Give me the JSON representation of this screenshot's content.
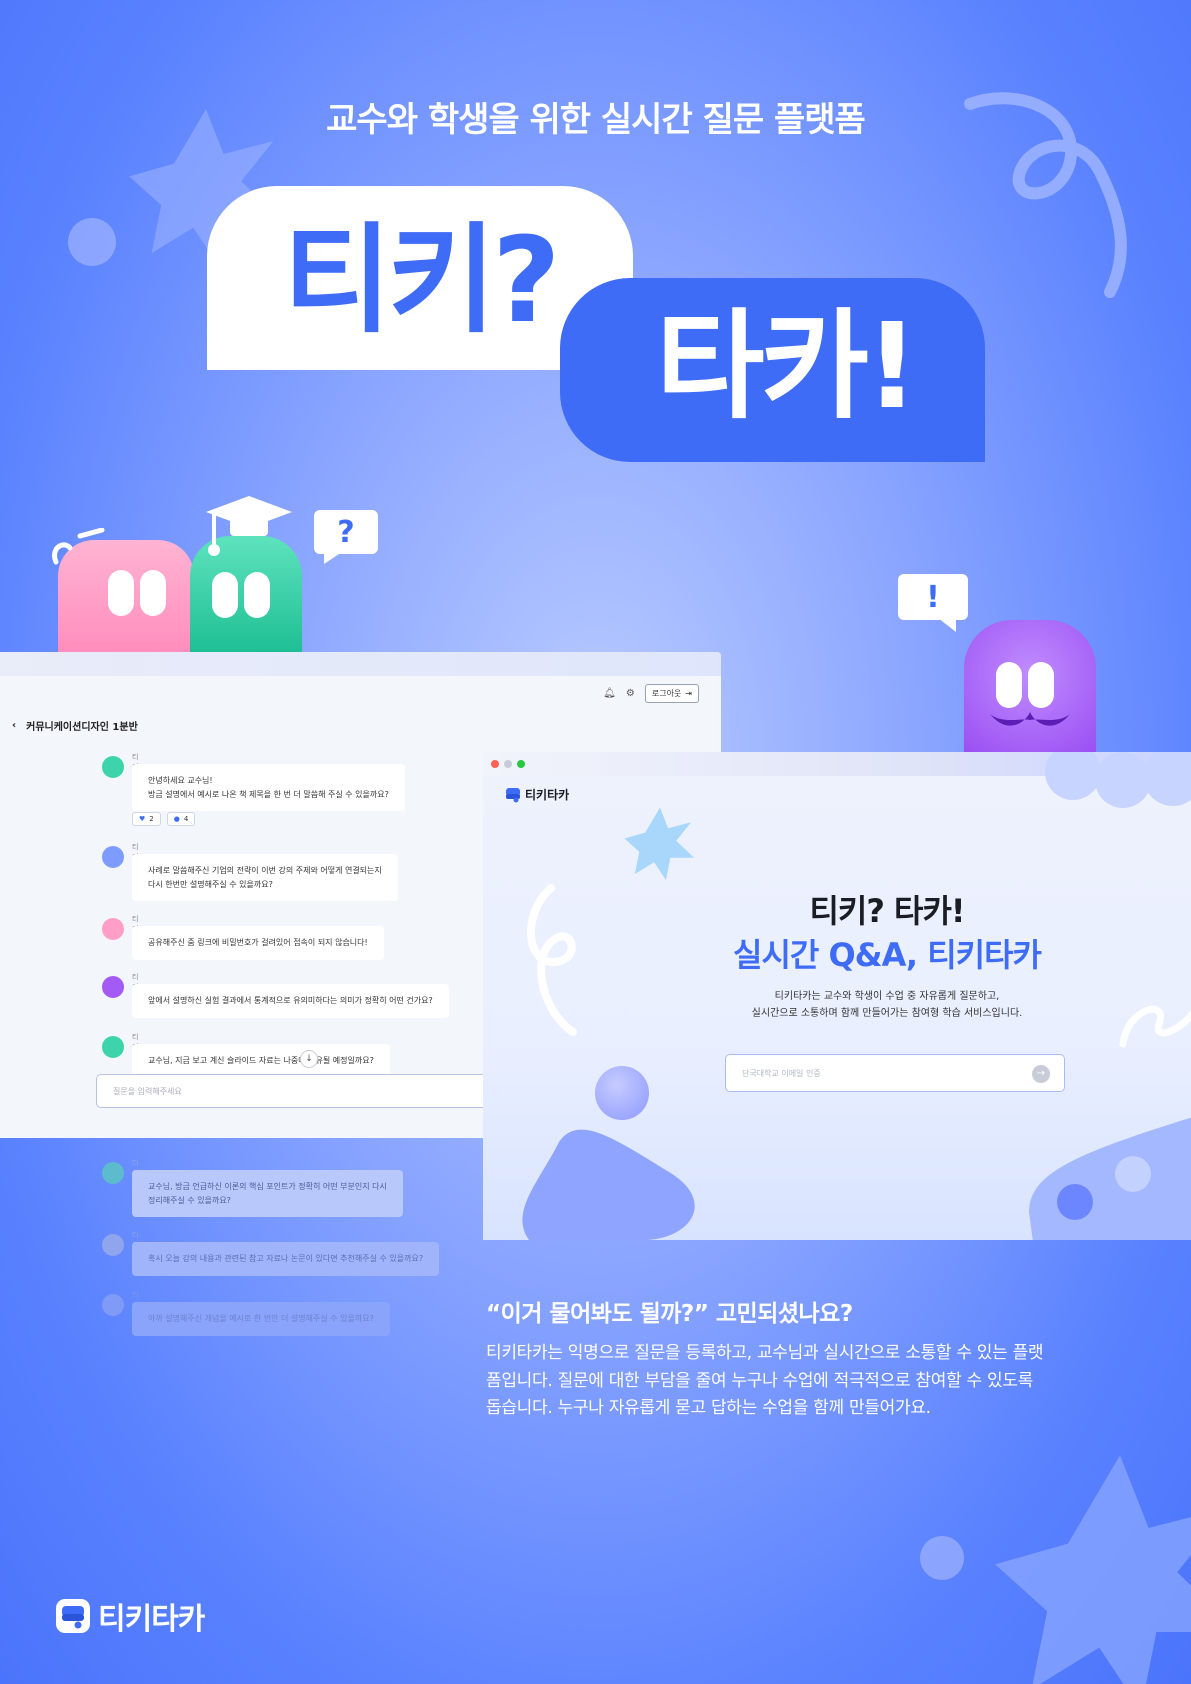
{
  "headline": "교수와 학생을 위한 실시간 질문 플랫폼",
  "hero": {
    "question_word": "티키?",
    "answer_word": "타카!"
  },
  "bubbles": {
    "question_mark": "?",
    "exclaim_mark": "!"
  },
  "chat": {
    "logout_label": "로그아웃",
    "class_title": "커뮤니케이션디자인 1분반",
    "messages": [
      {
        "name": "티키 01",
        "text_lines": [
          "안녕하세요 교수님!",
          "방금 설명에서 예시로 나온 책 제목을 한 번 더 말씀해 주실 수 있을까요?"
        ]
      },
      {
        "name": "티키 02",
        "text_lines": [
          "사례로 말씀해주신 기업의 전략이 이번 강의 주제와 어떻게 연결되는지",
          "다시 한번만 설명해주실 수 있을까요?"
        ]
      },
      {
        "name": "티키 03",
        "text_lines": [
          "공유해주신 줌 링크에 비밀번호가 걸려있어 접속이 되지 않습니다!"
        ]
      },
      {
        "name": "티키 04",
        "text_lines": [
          "앞에서 설명하신 실험 결과에서 통계적으로 유의미하다는 의미가 정확히 어떤 건가요?"
        ]
      },
      {
        "name": "티키 05",
        "text_lines": [
          "교수님, 지금 보고 계신 슬라이드 자료는 나중에 공유될 예정일까요?"
        ]
      }
    ],
    "reactions": [
      {
        "icon": "heart-icon",
        "count": "2"
      },
      {
        "icon": "question-icon",
        "count": "4"
      }
    ],
    "input_placeholder": "질문을 입력해주세요",
    "faded_messages": [
      {
        "name": "티키 06",
        "text_lines": [
          "교수님, 방금 언급하신 이론의 핵심 포인트가 정확히 어떤 부분인지 다시",
          "정리해주실 수 있을까요?"
        ]
      },
      {
        "name": "티키 07",
        "text_lines": [
          "혹시 오늘 강의 내용과 관련된 참고 자료나 논문이 있다면 추천해주실 수 있을까요?"
        ]
      },
      {
        "name": "티키 08",
        "text_lines": [
          "아까 설명해주신 개념을 예시로 한 번만 더 설명해주실 수 있을까요?"
        ]
      }
    ]
  },
  "landing": {
    "logo_text": "티키타카",
    "title_line1": "티키? 타카!",
    "title_line2": "실시간 Q&A, 티키타카",
    "desc_line1": "티키타카는 교수와 학생이 수업 중 자유롭게 질문하고,",
    "desc_line2": "실시간으로 소통하며 함께 만들어가는 참여형 학습 서비스입니다.",
    "email_placeholder": "단국대학교 이메일 인증"
  },
  "section": {
    "heading": "“이거 물어봐도 될까?” 고민되셨나요?",
    "body": "티키타카는 익명으로 질문을 등록하고, 교수님과 실시간으로 소통할 수 있는 플랫폼입니다. 질문에 대한 부담을 줄여 누구나 수업에 적극적으로 참여할 수 있도록 돕습니다. 누구나 자유롭게 묻고 답하는 수업을 함께 만들어가요."
  },
  "brand": {
    "name": "티키타카"
  },
  "colors": {
    "accent": "#3f6cf6",
    "pink": "#ff9fc7",
    "mint": "#34d1a8",
    "purple": "#a45bf5"
  }
}
